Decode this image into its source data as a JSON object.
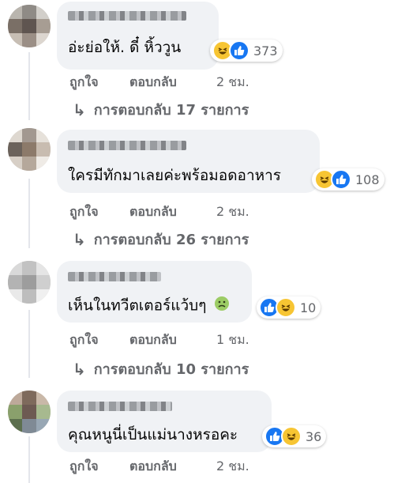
{
  "comments": [
    {
      "text": "อ่ะย่อให้. ดี๋ หิ้ววูน",
      "reactions": [
        "haha",
        "like"
      ],
      "count": "373",
      "like": "ถูกใจ",
      "reply": "ตอบกลับ",
      "time": "2 ชม.",
      "replies_label": "การตอบกลับ 17 รายการ"
    },
    {
      "text": "ใครมีทักมาเลยค่ะพร้อมอดอาหาร",
      "reactions": [
        "haha",
        "like"
      ],
      "count": "108",
      "like": "ถูกใจ",
      "reply": "ตอบกลับ",
      "time": "2 ชม.",
      "replies_label": "การตอบกลับ 26 รายการ"
    },
    {
      "text": "เห็นในทวีตเตอร์แว้บๆ",
      "text_emoji": "nauseated-face",
      "reactions": [
        "like",
        "haha"
      ],
      "count": "10",
      "like": "ถูกใจ",
      "reply": "ตอบกลับ",
      "time": "1 ชม.",
      "replies_label": "การตอบกลับ 10 รายการ"
    },
    {
      "text": "คุณหนูนี่เป็นแม่นางหรอคะ",
      "reactions": [
        "like",
        "haha"
      ],
      "count": "36",
      "like": "ถูกใจ",
      "reply": "ตอบกลับ",
      "time": "2 ชม."
    }
  ],
  "colors": {
    "bubble": "#f0f2f5",
    "like": "#1877f2",
    "haha": "#f7c533",
    "meta": "#65676b"
  }
}
